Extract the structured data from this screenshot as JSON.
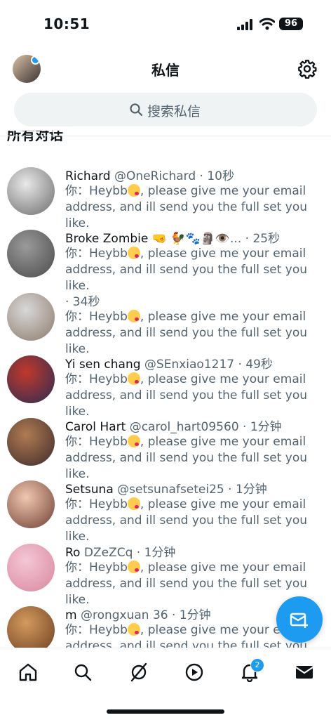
{
  "status": {
    "time": "10:51",
    "battery": "96"
  },
  "header": {
    "title": "私信"
  },
  "search": {
    "placeholder": "搜索私信"
  },
  "section_title": "所有对话",
  "conversations": [
    {
      "name": "Richard",
      "handle": "@OneRichard",
      "time": "· 10秒",
      "prefix": "你：",
      "msg_a": "Heybb",
      "msg_b": ", please give me your email address, and  ill send you the full set you like.",
      "avatar_colors": [
        "#e9e9e9",
        "#6b6b6b"
      ]
    },
    {
      "name": "Broke Zombie",
      "handle": "🤜 🐓🐾🗿👁️...",
      "time": "· 25秒",
      "prefix": "你：",
      "msg_a": "Heybb",
      "msg_b": ", please give me your email address, and  ill send you the full set you like.",
      "avatar_colors": [
        "#9a9a9a",
        "#4a4a4a"
      ]
    },
    {
      "name": "",
      "handle": "",
      "time": "· 34秒",
      "prefix": "你：",
      "msg_a": "Heybb",
      "msg_b": ", please give me your email address, and  ill send you the full set you like.",
      "avatar_colors": [
        "#d8d8d8",
        "#8c7b6b"
      ]
    },
    {
      "name": "Yi sen chang",
      "handle": "@SEnxiao1217",
      "time": "· 49秒",
      "prefix": "你：",
      "msg_a": "Heybb",
      "msg_b": ", please give me your email address, and  ill send you the full set you like.",
      "avatar_colors": [
        "#c0392b",
        "#2c2c54"
      ]
    },
    {
      "name": "Carol Hart",
      "handle": "@carol_hart09560",
      "time": "· 1分钟",
      "prefix": "你：",
      "msg_a": "Heybb",
      "msg_b": ", please give me your email address, and  ill send you the full set you like.",
      "avatar_colors": [
        "#b07b52",
        "#3d2b2b"
      ]
    },
    {
      "name": "Setsuna",
      "handle": "@setsunafsetei25",
      "time": "· 1分钟",
      "prefix": "你：",
      "msg_a": "Heybb",
      "msg_b": ", please give me your email address, and  ill send you the full set you like.",
      "avatar_colors": [
        "#f0c8b0",
        "#6e3d32"
      ]
    },
    {
      "name": "Ro",
      "handle": "DZeZCq",
      "time": "· 1分钟",
      "prefix": "你：",
      "msg_a": "Heybb",
      "msg_b": ", please give me your email address, and  ill send you the full set you like.",
      "avatar_colors": [
        "#f4c7d6",
        "#d9869e"
      ]
    },
    {
      "name": "m",
      "handle": "@rongxuan 36",
      "time": "· 1分钟",
      "prefix": "你：",
      "msg_a": "Heybb",
      "msg_b": ", please give me your email address, and  ill send you the full set you like.",
      "avatar_colors": [
        "#d49a5e",
        "#6b3e20"
      ]
    }
  ],
  "tabbar": {
    "notifications_badge": "2"
  },
  "colors": {
    "accent": "#1d9bf0",
    "text_secondary": "#536471"
  }
}
